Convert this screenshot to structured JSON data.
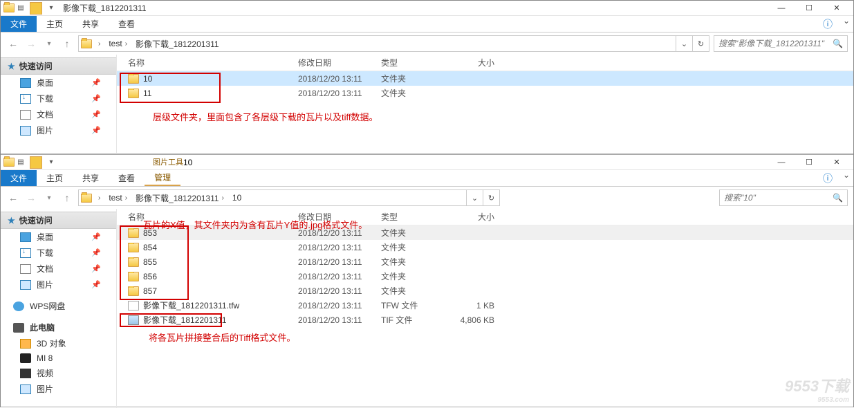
{
  "window1": {
    "title": "影像下载_1812201311",
    "tabs": {
      "file": "文件",
      "home": "主页",
      "share": "共享",
      "view": "查看"
    },
    "breadcrumb": [
      "test",
      "影像下载_1812201311"
    ],
    "search_placeholder": "搜索\"影像下载_1812201311\"",
    "columns": {
      "name": "名称",
      "date": "修改日期",
      "type": "类型",
      "size": "大小"
    },
    "rows": [
      {
        "name": "10",
        "date": "2018/12/20 13:11",
        "type": "文件夹",
        "size": "",
        "icon": "folder",
        "selected": true
      },
      {
        "name": "11",
        "date": "2018/12/20 13:11",
        "type": "文件夹",
        "size": "",
        "icon": "folder",
        "selected": false
      }
    ]
  },
  "window2": {
    "title": "10",
    "tool_group": "图片工具",
    "tool_sub": "管理",
    "tabs": {
      "file": "文件",
      "home": "主页",
      "share": "共享",
      "view": "查看"
    },
    "breadcrumb": [
      "test",
      "影像下载_1812201311",
      "10"
    ],
    "search_placeholder": "搜索\"10\"",
    "columns": {
      "name": "名称",
      "date": "修改日期",
      "type": "类型",
      "size": "大小"
    },
    "rows": [
      {
        "name": "853",
        "date": "2018/12/20 13:11",
        "type": "文件夹",
        "size": "",
        "icon": "folder"
      },
      {
        "name": "854",
        "date": "2018/12/20 13:11",
        "type": "文件夹",
        "size": "",
        "icon": "folder"
      },
      {
        "name": "855",
        "date": "2018/12/20 13:11",
        "type": "文件夹",
        "size": "",
        "icon": "folder"
      },
      {
        "name": "856",
        "date": "2018/12/20 13:11",
        "type": "文件夹",
        "size": "",
        "icon": "folder"
      },
      {
        "name": "857",
        "date": "2018/12/20 13:11",
        "type": "文件夹",
        "size": "",
        "icon": "folder"
      },
      {
        "name": "影像下载_1812201311.tfw",
        "date": "2018/12/20 13:11",
        "type": "TFW 文件",
        "size": "1 KB",
        "icon": "file"
      },
      {
        "name": "影像下载_1812201311",
        "date": "2018/12/20 13:11",
        "type": "TIF 文件",
        "size": "4,806 KB",
        "icon": "tif"
      }
    ]
  },
  "sidebar": {
    "quick_access": "快速访问",
    "items_main": [
      {
        "label": "桌面",
        "icon": "blue-sq",
        "pin": true
      },
      {
        "label": "下载",
        "icon": "dl-ic",
        "pin": true
      },
      {
        "label": "文档",
        "icon": "doc-ic",
        "pin": true
      },
      {
        "label": "图片",
        "icon": "pic-ic",
        "pin": true
      }
    ],
    "wps": "WPS网盘",
    "this_pc": "此电脑",
    "items_pc": [
      {
        "label": "3D 对象",
        "icon": "cube-ic"
      },
      {
        "label": "MI 8",
        "icon": "phone-ic"
      },
      {
        "label": "视频",
        "icon": "vid-ic"
      },
      {
        "label": "图片",
        "icon": "pic-ic"
      }
    ]
  },
  "annotations": {
    "a1": "层级文件夹，里面包含了各层级下载的瓦片以及tiff数据。",
    "a2": "瓦片的X值，其文件夹内为含有瓦片Y值的.jpg格式文件。",
    "a3": "将各瓦片拼接整合后的Tiff格式文件。"
  },
  "watermark": {
    "main": "9553下载",
    "sub": "9553.com"
  }
}
